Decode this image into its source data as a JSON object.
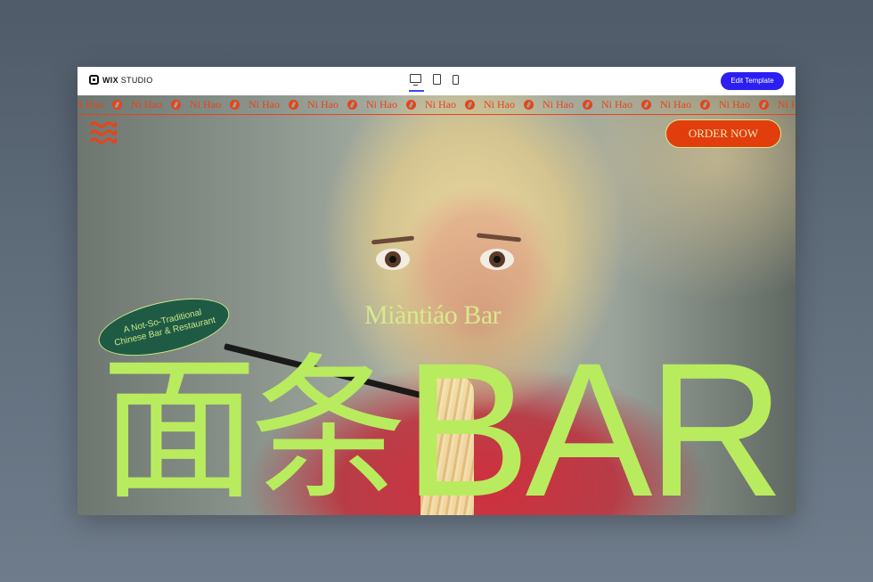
{
  "editor": {
    "brand": "WIX",
    "brand_suffix": "STUDIO",
    "edit_template_label": "Edit Template"
  },
  "site": {
    "ticker_text": "Ni Hao",
    "order_label": "ORDER NOW",
    "subtitle": "Miàntiáo Bar",
    "badge_text": "A Not-So-Traditional Chinese Bar & Restaurant",
    "big_title_cn": "面条",
    "big_title_en": "BAR"
  },
  "colors": {
    "accent_orange": "#e8431a",
    "lime": "#b9eb5f",
    "badge_green": "#1f5a45",
    "wix_blue": "#2c1ff2"
  }
}
